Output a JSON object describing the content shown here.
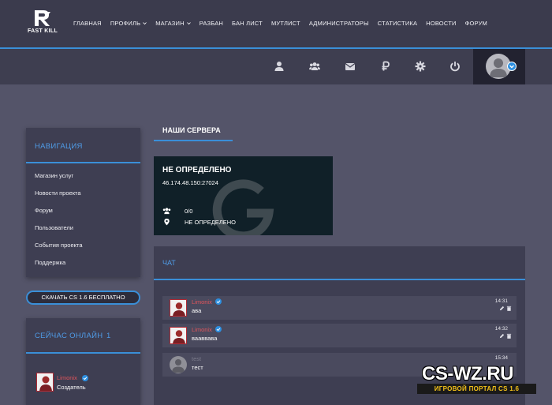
{
  "logo": {
    "text": "FAST KILL"
  },
  "nav": {
    "items": [
      {
        "label": "ГЛАВНАЯ",
        "dropdown": false
      },
      {
        "label": "ПРОФИЛЬ",
        "dropdown": true
      },
      {
        "label": "МАГАЗИН",
        "dropdown": true
      },
      {
        "label": "РАЗБАН",
        "dropdown": false
      },
      {
        "label": "БАН ЛИСТ",
        "dropdown": false
      },
      {
        "label": "МУТЛИСТ",
        "dropdown": false
      },
      {
        "label": "АДМИНИСТРАТОРЫ",
        "dropdown": false
      },
      {
        "label": "СТАТИСТИКА",
        "dropdown": false
      },
      {
        "label": "НОВОСТИ",
        "dropdown": false
      },
      {
        "label": "ФОРУМ",
        "dropdown": false
      }
    ]
  },
  "toolbar": {
    "icons": [
      "user-icon",
      "users-icon",
      "mail-icon",
      "ruble-icon",
      "gear-icon",
      "power-icon"
    ]
  },
  "sidebar": {
    "nav_title": "НАВИГАЦИЯ",
    "links": [
      {
        "label": "Магазин услуг"
      },
      {
        "label": "Новости проекта"
      },
      {
        "label": "Форум"
      },
      {
        "label": "Пользователи"
      },
      {
        "label": "События проекта"
      },
      {
        "label": "Поддержка"
      }
    ],
    "download_label": "СКАЧАТЬ CS 1.6 БЕСПЛАТНО",
    "online_title": "СЕЙЧАС ОНЛАЙН",
    "online_count": "1",
    "online_user": {
      "name": "Limonix",
      "role": "Создатель"
    }
  },
  "servers": {
    "tab_label": "НАШИ СЕРВЕРА",
    "card": {
      "title": "НЕ ОПРЕДЕЛЕНО",
      "ip": "46.174.48.150:27024",
      "players": "0/0",
      "map": "НЕ ОПРЕДЕЛЕНО"
    }
  },
  "chat": {
    "title": "ЧАТ",
    "messages": [
      {
        "author": "Limonix",
        "text": "ава",
        "time": "14:31"
      },
      {
        "author": "Limonix",
        "text": "вааввава",
        "time": "14:32"
      },
      {
        "author": "test",
        "text": "тест",
        "time": "15:34"
      }
    ]
  },
  "watermark": {
    "main": "CS-WZ.RU",
    "sub": "ИГРОВОЙ ПОРТАЛ CS 1.6"
  },
  "colors": {
    "accent": "#3a8fd8",
    "author_red": "#e0555c",
    "background": "#545469"
  }
}
